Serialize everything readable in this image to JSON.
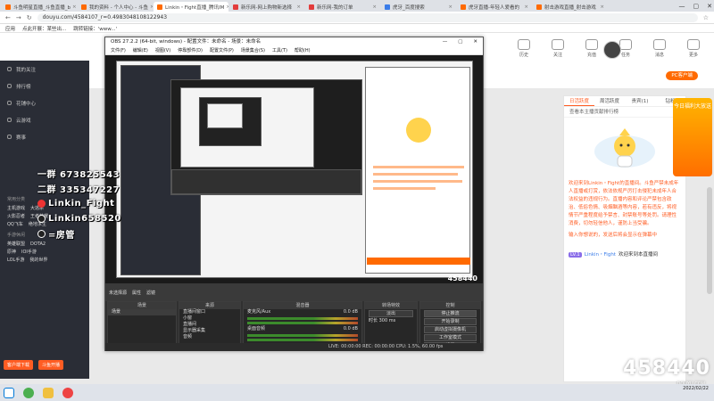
{
  "browser": {
    "tabs": [
      {
        "title": "斗鱼明星直播_斗鱼直播_b",
        "color": "#ff6a00",
        "active": false
      },
      {
        "title": "我的资料 - 个人中心 - 斗鱼",
        "color": "#ff6a00",
        "active": false
      },
      {
        "title": "Linkin・Fight直播_腾讯IM",
        "color": "#ff6a00",
        "active": true
      },
      {
        "title": "新乐网-网上购物新选择",
        "color": "#e33c3c",
        "active": false
      },
      {
        "title": "新乐网-我的订单",
        "color": "#e33c3c",
        "active": false
      },
      {
        "title": "虎牙_百度搜索",
        "color": "#3b7de9",
        "active": false
      },
      {
        "title": "虎牙直播-年轻人爱看的",
        "color": "#ff6a00",
        "active": false
      },
      {
        "title": "射击游戏直播_射击游戏",
        "color": "#ff6a00",
        "active": false
      }
    ],
    "url": "douyu.com/4584107_r=0.4983048108122943",
    "bookmarks": [
      "应用",
      "点此开展：某些出...",
      "跳转链接：'www...'"
    ],
    "window_controls": [
      "—",
      "▢",
      "✕"
    ]
  },
  "site": {
    "nav_items": [
      {
        "label": "历史"
      },
      {
        "label": "关注"
      },
      {
        "label": "充值"
      },
      {
        "label": "任务"
      },
      {
        "label": "消息"
      },
      {
        "label": "更多"
      }
    ],
    "pc_button": "PC客户端",
    "sidebar": {
      "items": [
        "我的关注",
        "排行榜",
        "花铺中心",
        "云游戏",
        "赛事"
      ],
      "section_label": "常用分类",
      "categories": [
        [
          "主机游戏",
          "大逃杀"
        ],
        [
          "火影忍者",
          "王者荣耀"
        ],
        [
          "QQ飞车",
          "绝地求生"
        ]
      ],
      "section2_label": "手游休闲",
      "categories2": [
        [
          "英雄联盟",
          "DOTA2"
        ],
        [
          "原神",
          "IOI手游"
        ],
        [
          "LOL手游",
          "我的世界"
        ]
      ],
      "buttons": [
        "客户端下载",
        "斗鱼开播"
      ]
    },
    "right_panel": {
      "tabs": [
        "日活跃度",
        "周活跃度",
        "贵宾(1)",
        "钻粉"
      ],
      "active_tab": 0,
      "rank_text": "查看本主播贡献排行榜",
      "chat": [
        "欢迎来到Linkin・Fight的直播间。斗鱼严禁未成年人直播或打赏，依法依规严厉打击侵犯未成年人合法权益的违规行为。直播内容和评论严禁包含政治、低俗色情、吸烟酗酒等内容，若有违反，将视情节严重程度给予禁言、封禁账号等处罚。请理性消费，切勿轻信他人，谨防上当受骗。",
        "输入你想说的，发送后将会显示在弹幕中"
      ],
      "welcome": {
        "badge": "LV.1",
        "name": "Linkin・Fight",
        "text": "欢迎来到本直播间"
      }
    },
    "ad_banner": "今日福利大放送",
    "watermark": "斗鱼",
    "watermark_sub": "DOUYU.COM",
    "room_id": "458440"
  },
  "obs": {
    "title": "OBS 27.2.2 (64-bit, windows) - 配置文件：未命名 - 场景：未命名",
    "menu": [
      "文件(F)",
      "编辑(E)",
      "视图(V)",
      "停靠部件(D)",
      "配置文件(P)",
      "场景集合(S)",
      "工具(T)",
      "帮助(H)"
    ],
    "label_bar": [
      "未选择源",
      "属性",
      "滤镜"
    ],
    "docks": {
      "scenes": {
        "title": "场景",
        "items": [
          "场景"
        ]
      },
      "sources": {
        "title": "来源",
        "items": [
          "直播间窗口",
          "小窗",
          "直播间",
          "显示器采集",
          "音频",
          "窗口(3)"
        ]
      },
      "mixer": {
        "title": "混音器",
        "channels": [
          {
            "name": "麦克风/Aux",
            "db": "0.0 dB"
          },
          {
            "name": "桌面音频",
            "db": "0.0 dB"
          }
        ]
      },
      "transitions": {
        "title": "转场特效",
        "mode": "淡出",
        "duration_label": "时长",
        "duration": "300 ms"
      },
      "controls": {
        "title": "控制",
        "buttons": [
          "停止推流",
          "开始录制",
          "启动虚拟摄像机",
          "工作室模式",
          "设置",
          "退出"
        ]
      }
    },
    "status": "LIVE: 00:00:00    REC: 00:00:00    CPU: 1.5%, 60.00 fps",
    "preview_count": "458440"
  },
  "overlay": {
    "lines": [
      {
        "icon": "none",
        "text": "一群 673825543"
      },
      {
        "icon": "none",
        "text": "二群 335347227"
      },
      {
        "icon": "weibo",
        "text": "Linkin_Fight"
      },
      {
        "icon": "douyin",
        "text": "Linkin658520"
      },
      {
        "icon": "douyin",
        "text": "=房管"
      }
    ]
  },
  "taskbar": {
    "clock": "2022/02/22"
  }
}
